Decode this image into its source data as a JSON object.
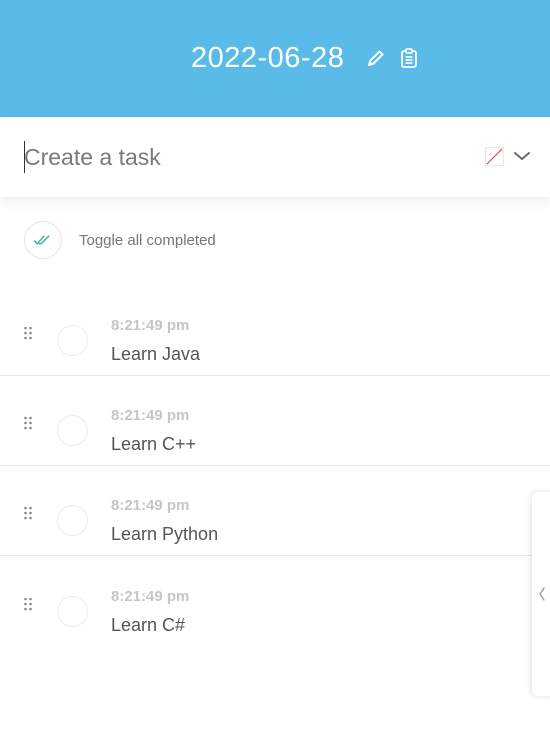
{
  "header": {
    "date": "2022-06-28",
    "edit_icon": "pencil-icon",
    "clipboard_icon": "clipboard-icon"
  },
  "create": {
    "placeholder": "Create a task",
    "color_icon": "color-swatch-icon",
    "dropdown_icon": "chevron-down-icon"
  },
  "toggle_all": {
    "label": "Toggle all completed",
    "icon": "double-check-icon"
  },
  "tasks": [
    {
      "time": "8:21:49 pm",
      "title": "Learn Java"
    },
    {
      "time": "8:21:49 pm",
      "title": "Learn C++"
    },
    {
      "time": "8:21:49 pm",
      "title": "Learn Python"
    },
    {
      "time": "8:21:49 pm",
      "title": "Learn C#"
    }
  ],
  "colors": {
    "header_bg": "#5bbbe8",
    "check_accent": "#3fb8a6"
  },
  "side_panel": {
    "icon": "chevron-left-icon"
  }
}
